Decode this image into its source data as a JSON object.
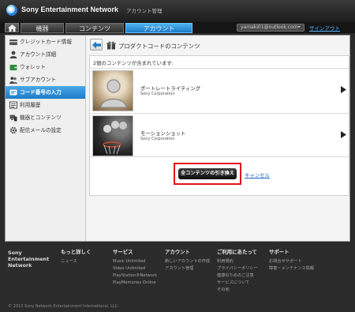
{
  "header": {
    "brand": "Sony Entertainment Network",
    "subtitle": "アカウント管理",
    "tabs": [
      {
        "label": "機器"
      },
      {
        "label": "コンテンツ"
      },
      {
        "label": "アカウント"
      }
    ],
    "active_tab": "アカウント",
    "account_email": "yamaki01@outlook.com",
    "signout": "サインアウト"
  },
  "sidebar": {
    "items": [
      {
        "label": "クレジットカード情報",
        "icon": "credit-card-icon"
      },
      {
        "label": "アカウント詳細",
        "icon": "user-icon"
      },
      {
        "label": "ウォレット",
        "icon": "wallet-icon"
      },
      {
        "label": "サブアカウント",
        "icon": "users-icon"
      },
      {
        "label": "コード番号の入力",
        "icon": "key-icon"
      },
      {
        "label": "利用履歴",
        "icon": "list-icon"
      },
      {
        "label": "機器とコンテンツ",
        "icon": "devices-icon"
      },
      {
        "label": "配信メールの設定",
        "icon": "gear-icon"
      }
    ],
    "active": "コード番号の入力"
  },
  "main": {
    "title": "プロダクトコードのコンテンツ",
    "list_heading": "2個のコンテンツが含まれています:",
    "items": [
      {
        "name": "ポートレートライティング",
        "vendor": "Sony Corporation"
      },
      {
        "name": "モーションショット",
        "vendor": "Sony Corporation"
      }
    ],
    "redeem_button": "全コンテンツの引き換え",
    "cancel_link": "キャンセル"
  },
  "footer": {
    "brand": "Sony Entertainment Network",
    "columns": [
      {
        "heading": "もっと詳しく",
        "links": [
          "ニュース"
        ]
      },
      {
        "heading": "サービス",
        "links": [
          "Music Unlimited",
          "Video Unlimited",
          "PlayStation®Network",
          "PlayMemories Online"
        ]
      },
      {
        "heading": "アカウント",
        "links": [
          "新しいアカウントの作成",
          "アカウント管理"
        ]
      },
      {
        "heading": "ご利用にあたって",
        "links": [
          "利用規約",
          "プライバシーポリシー",
          "健康のためのご注意",
          "サービスについて",
          "その他"
        ]
      },
      {
        "heading": "サポート",
        "links": [
          "お問合せサポート",
          "障害・メンテナンス情報"
        ]
      }
    ],
    "copyright": "© 2013 Sony Network Entertainment International, LLC"
  },
  "colors": {
    "accent": "#1e7bc6",
    "highlight_box": "#e0141b"
  }
}
